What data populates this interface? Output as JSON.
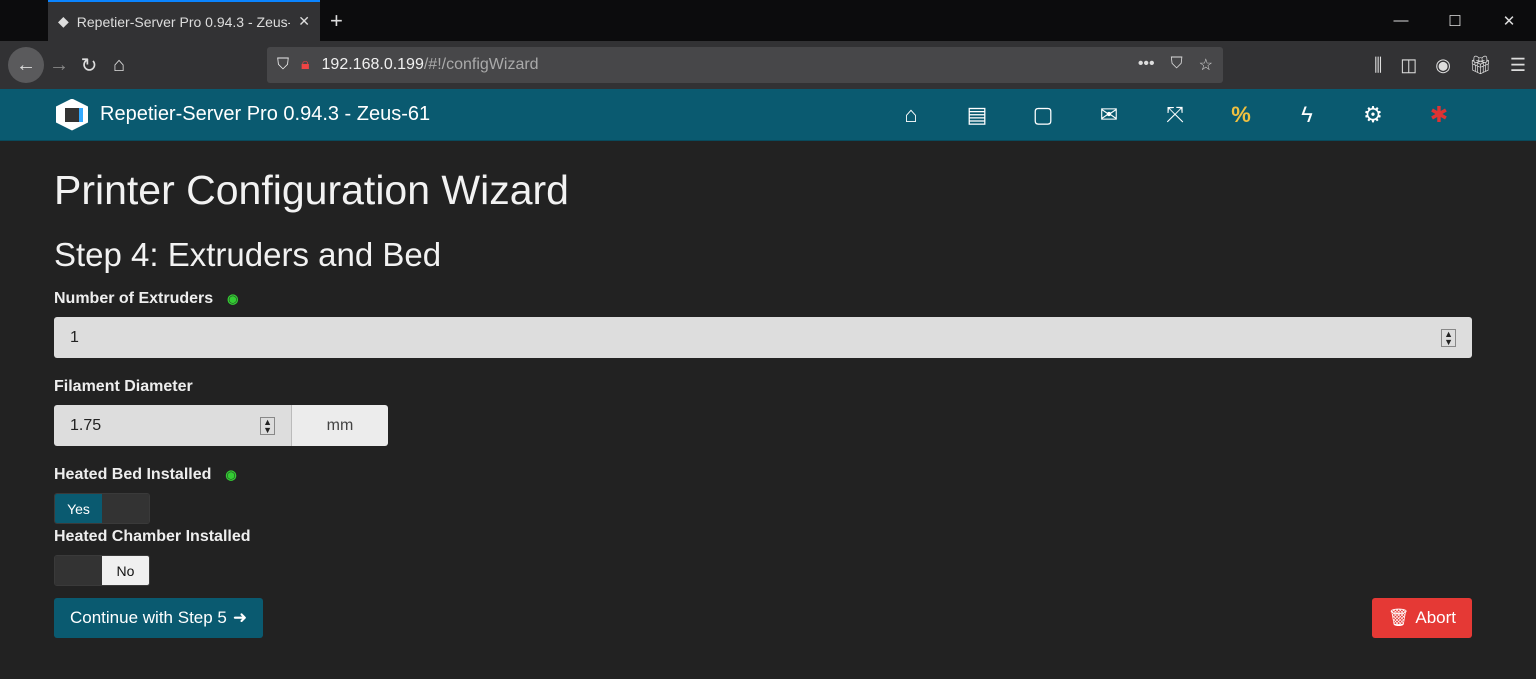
{
  "browser": {
    "tab_title": "Repetier-Server Pro 0.94.3 - Zeus-61",
    "url_host": "192.168.0.199",
    "url_path": "/#!/configWizard"
  },
  "app": {
    "title": "Repetier-Server Pro 0.94.3 - Zeus-61",
    "nav_icons": [
      "home-icon",
      "archive-icon",
      "printer-icon",
      "envelope-icon",
      "expand-icon",
      "percent-icon",
      "bolt-icon",
      "gear-icon",
      "uk-flag-icon"
    ]
  },
  "page": {
    "title": "Printer Configuration Wizard",
    "step": "Step 4: Extruders and Bed"
  },
  "form": {
    "extruders_label": "Number of Extruders",
    "extruders_value": "1",
    "filament_label": "Filament Diameter",
    "filament_value": "1.75",
    "filament_unit": "mm",
    "bed_label": "Heated Bed Installed",
    "bed_value": "Yes",
    "chamber_label": "Heated Chamber Installed",
    "chamber_value": "No"
  },
  "actions": {
    "continue": "Continue with Step 5",
    "abort": "Abort"
  },
  "colors": {
    "header": "#0a5a70",
    "abort": "#e53935",
    "ok": "#33cc33"
  }
}
